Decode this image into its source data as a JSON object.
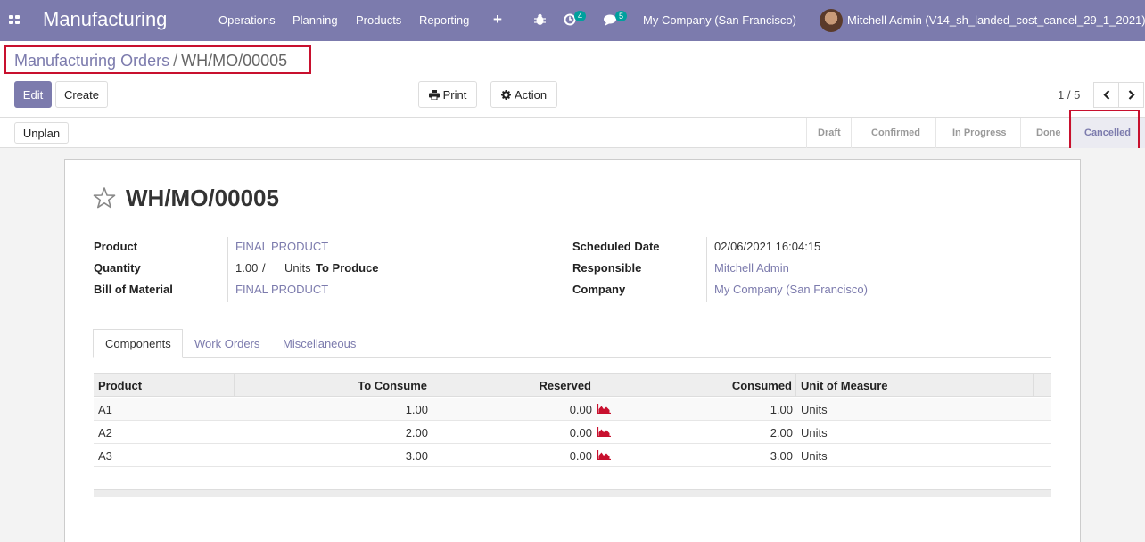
{
  "navbar": {
    "app_title": "Manufacturing",
    "menu": [
      "Operations",
      "Planning",
      "Products",
      "Reporting"
    ],
    "activity_count": "4",
    "messages_count": "5",
    "company": "My Company (San Francisco)",
    "user": "Mitchell Admin (V14_sh_landed_cost_cancel_29_1_2021)"
  },
  "breadcrumb": {
    "parent": "Manufacturing Orders",
    "separator": "/",
    "current": "WH/MO/00005"
  },
  "buttons": {
    "edit": "Edit",
    "create": "Create",
    "print": "Print",
    "action": "Action",
    "unplan": "Unplan"
  },
  "pager": {
    "value": "1 / 5"
  },
  "status_steps": [
    "Draft",
    "Confirmed",
    "In Progress",
    "Done",
    "Cancelled"
  ],
  "status_active": "Cancelled",
  "record": {
    "title": "WH/MO/00005",
    "product_label": "Product",
    "product": "FINAL PRODUCT",
    "quantity_label": "Quantity",
    "quantity": "1.00",
    "quantity_sep": "/",
    "uom": "Units",
    "to_produce": "To Produce",
    "bom_label": "Bill of Material",
    "bom": "FINAL PRODUCT",
    "scheduled_label": "Scheduled Date",
    "scheduled": "02/06/2021 16:04:15",
    "responsible_label": "Responsible",
    "responsible": "Mitchell Admin",
    "company_label": "Company",
    "company": "My Company (San Francisco)"
  },
  "tabs": [
    "Components",
    "Work Orders",
    "Miscellaneous"
  ],
  "table": {
    "columns": [
      "Product",
      "To Consume",
      "Reserved",
      "Consumed",
      "Unit of Measure"
    ],
    "rows": [
      {
        "product": "A1",
        "to_consume": "1.00",
        "reserved": "0.00",
        "consumed": "1.00",
        "uom": "Units"
      },
      {
        "product": "A2",
        "to_consume": "2.00",
        "reserved": "0.00",
        "consumed": "2.00",
        "uom": "Units"
      },
      {
        "product": "A3",
        "to_consume": "3.00",
        "reserved": "0.00",
        "consumed": "3.00",
        "uom": "Units"
      }
    ]
  },
  "colors": {
    "brand": "#7c7bad",
    "annotation": "#c8102e",
    "forecast_icon": "#c8102e",
    "badge": "#00a09d"
  }
}
